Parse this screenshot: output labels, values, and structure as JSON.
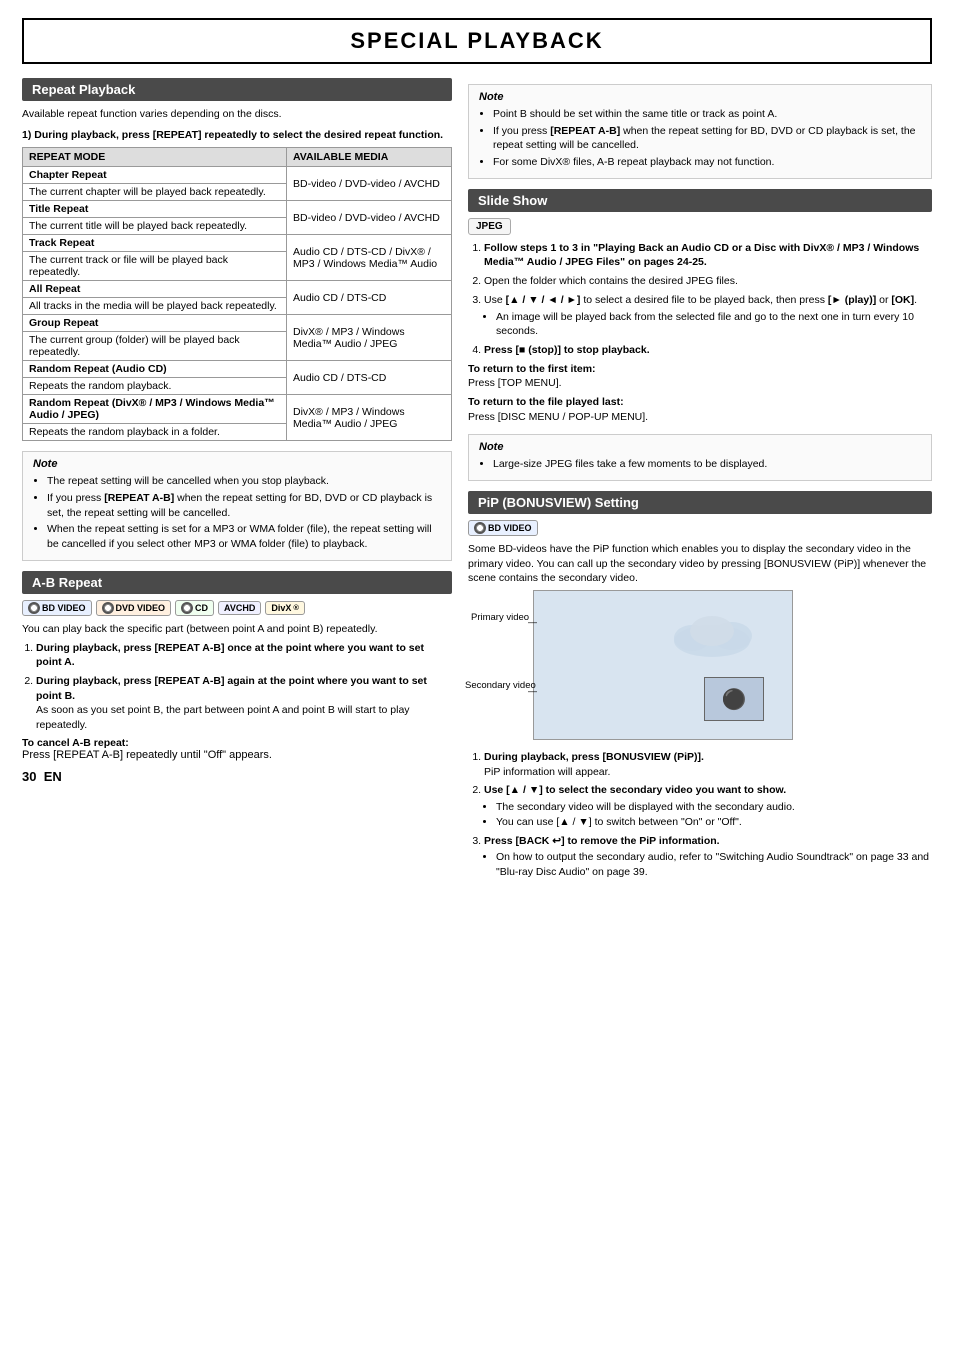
{
  "page": {
    "title": "SPECIAL PLAYBACK",
    "page_number": "30",
    "page_suffix": "EN"
  },
  "repeat_section": {
    "header": "Repeat Playback",
    "intro": "Available repeat function varies depending on the discs.",
    "step1_bold": "1)  During playback, press [REPEAT] repeatedly to select the desired repeat function.",
    "table_headers": [
      "REPEAT MODE",
      "AVAILABLE MEDIA"
    ],
    "table_rows": [
      {
        "mode": "Chapter Repeat",
        "mode_desc": "The current chapter will be played back repeatedly.",
        "media": "BD-video / DVD-video / AVCHD",
        "bold_mode": true
      },
      {
        "mode": "Title Repeat",
        "mode_desc": "The current title will be played back repeatedly.",
        "media": "BD-video / DVD-video / AVCHD",
        "bold_mode": true
      },
      {
        "mode": "Track Repeat",
        "mode_desc": "The current track or file will be played back repeatedly.",
        "media": "Audio CD / DTS-CD / DivX® / MP3 / Windows Media™ Audio",
        "bold_mode": true
      },
      {
        "mode": "All Repeat",
        "mode_desc": "All tracks in the media will be played back repeatedly.",
        "media": "Audio CD / DTS-CD",
        "bold_mode": true
      },
      {
        "mode": "Group Repeat",
        "mode_desc": "The current group (folder) will be played back repeatedly.",
        "media": "DivX® / MP3 / Windows Media™ Audio / JPEG",
        "bold_mode": true
      },
      {
        "mode": "Random Repeat (Audio CD)",
        "mode_desc": "Repeats the random playback.",
        "media": "Audio CD / DTS-CD",
        "bold_mode": true
      },
      {
        "mode": "Random Repeat (DivX® / MP3 / Windows Media™ Audio / JPEG)",
        "mode_desc": "Repeats the random playback in a folder.",
        "media": "DivX® / MP3 / Windows Media™ Audio / JPEG",
        "bold_mode": true
      }
    ],
    "note_title": "Note",
    "note_items": [
      "The repeat setting will be cancelled when you stop playback.",
      "If you press [REPEAT A-B] when the repeat setting for BD, DVD or CD playback is set, the repeat setting will be cancelled.",
      "When the repeat setting is set for a MP3 or WMA folder (file), the repeat setting will be cancelled if you select other MP3 or WMA folder (file) to playback."
    ]
  },
  "ab_section": {
    "header": "A-B Repeat",
    "badges": [
      "BD",
      "DVD",
      "CD",
      "AVCHD",
      "DivX"
    ],
    "intro": "You can play back the specific part (between point A and point B) repeatedly.",
    "steps": [
      {
        "num": "1)",
        "bold": "During playback, press [REPEAT A-B] once at the point where you want to set point A."
      },
      {
        "num": "2)",
        "bold": "During playback, press [REPEAT A-B] again at the point where you want to set point B.",
        "sub": "As soon as you set point B, the part between point A and point B will start to play repeatedly."
      }
    ],
    "to_cancel_label": "To cancel A-B repeat:",
    "to_cancel_text": "Press [REPEAT A-B] repeatedly until \"Off\" appears."
  },
  "right_col": {
    "note_section_1": {
      "title": "Note",
      "items": [
        "Point B should be set within the same title or track as point A.",
        "If you press [REPEAT A-B] when the repeat setting for BD, DVD or CD playback is set, the repeat setting will be cancelled.",
        "For some DivX® files, A-B repeat playback may not function."
      ]
    },
    "slide_section": {
      "header": "Slide Show",
      "badge": "JPEG",
      "steps": [
        {
          "num": "1)",
          "bold": true,
          "text": "Follow steps 1 to 3 in \"Playing Back an Audio CD or a Disc with DivX® / MP3 / Windows Media™ Audio / JPEG Files\" on pages 24-25."
        },
        {
          "num": "2)",
          "bold": false,
          "text": "Open the folder which contains the desired JPEG files."
        },
        {
          "num": "3)",
          "bold": false,
          "text": "Use [▲ / ▼ / ◄ / ►] to select a desired file to be played back, then press [► (play)] or [OK].",
          "sub_items": [
            "An image will be played back from the selected file and go to the next one in turn every 10 seconds."
          ]
        },
        {
          "num": "4)",
          "bold": true,
          "text": "Press [■ (stop)] to stop playback."
        }
      ],
      "to_return_label": "To return to the first item:",
      "to_return_text": "Press [TOP MENU].",
      "to_return2_label": "To return to the file played last:",
      "to_return2_text": "Press [DISC MENU / POP-UP MENU]."
    },
    "slide_note": {
      "title": "Note",
      "items": [
        "Large-size JPEG files take a few moments to be displayed."
      ]
    },
    "pip_section": {
      "header": "PiP (BONUSVIEW) Setting",
      "badge": "BD",
      "intro": "Some BD-videos have the PiP function which enables you to display the secondary video in the primary video. You can call up the secondary video by pressing [BONUSVIEW (PiP)] whenever the scene contains the secondary video.",
      "primary_label": "Primary video",
      "secondary_label": "Secondary video",
      "steps": [
        {
          "num": "1)",
          "bold": true,
          "text": "During playback, press [BONUSVIEW (PiP)].",
          "sub": "PiP information will appear."
        },
        {
          "num": "2)",
          "bold": true,
          "text": "Use [▲ / ▼] to select the secondary video you want to show.",
          "sub_items": [
            "The secondary video will be displayed with the secondary audio.",
            "You can use [▲ / ▼] to switch between \"On\" or \"Off\"."
          ]
        },
        {
          "num": "3)",
          "bold": true,
          "text": "Press [BACK ↩] to remove the PiP information.",
          "sub_items": [
            "On how to output the secondary audio, refer to \"Switching Audio Soundtrack\" on page 33 and \"Blu-ray Disc Audio\" on page 39."
          ]
        }
      ]
    }
  }
}
